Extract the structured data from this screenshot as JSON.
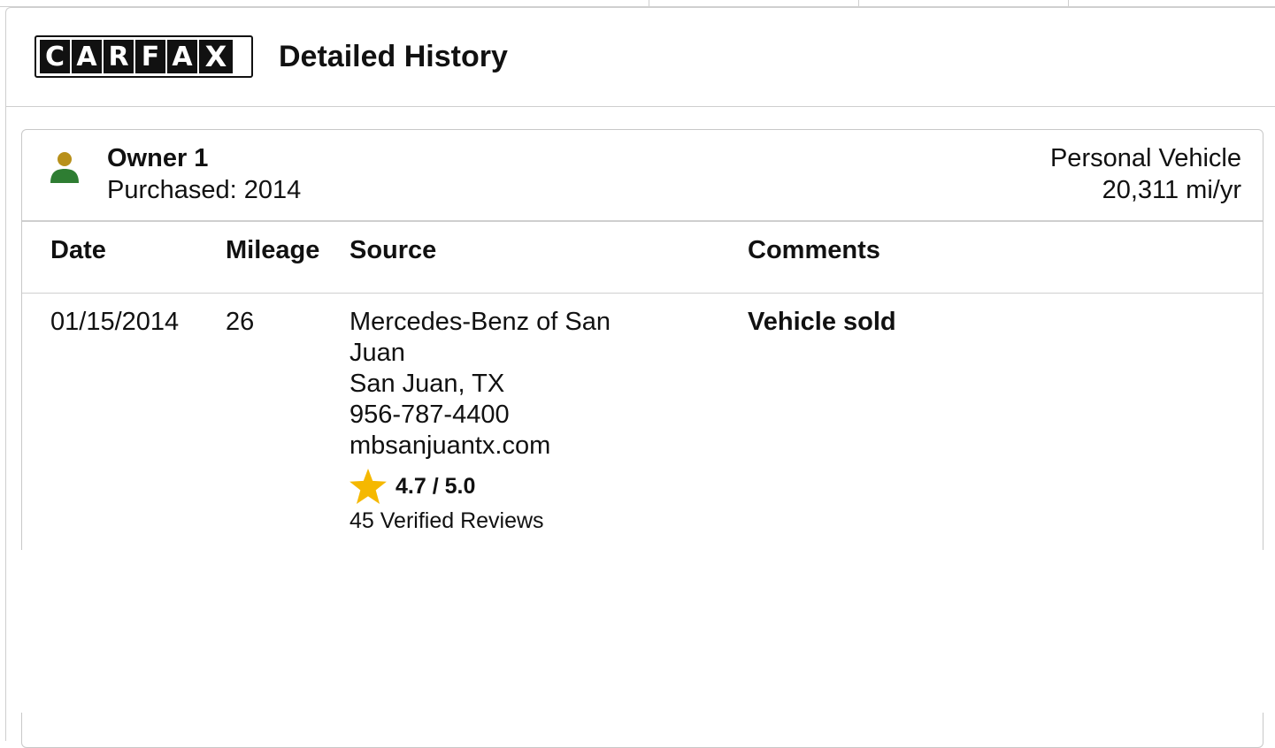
{
  "header": {
    "logo_letters": [
      "C",
      "A",
      "R",
      "F",
      "A",
      "X"
    ],
    "title": "Detailed History"
  },
  "owner": {
    "name": "Owner 1",
    "purchased": "Purchased: 2014",
    "vehicle_type": "Personal Vehicle",
    "miles_per_year": "20,311 mi/yr",
    "icon": "person-icon",
    "icon_head_color": "#b8901a",
    "icon_body_color": "#2e7d32"
  },
  "table": {
    "columns": [
      "Date",
      "Mileage",
      "Source",
      "Comments"
    ],
    "rows": [
      {
        "date": "01/15/2014",
        "mileage": "26",
        "source": {
          "name_line1": "Mercedes-Benz of San",
          "name_line2": "Juan",
          "location": "San Juan, TX",
          "phone": "956-787-4400",
          "website": "mbsanjuantx.com",
          "rating": "4.7 / 5.0",
          "reviews": "45 Verified Reviews"
        },
        "comment": "Vehicle sold"
      }
    ]
  },
  "colors": {
    "star": "#f5b800",
    "border": "#cfcfcf"
  }
}
